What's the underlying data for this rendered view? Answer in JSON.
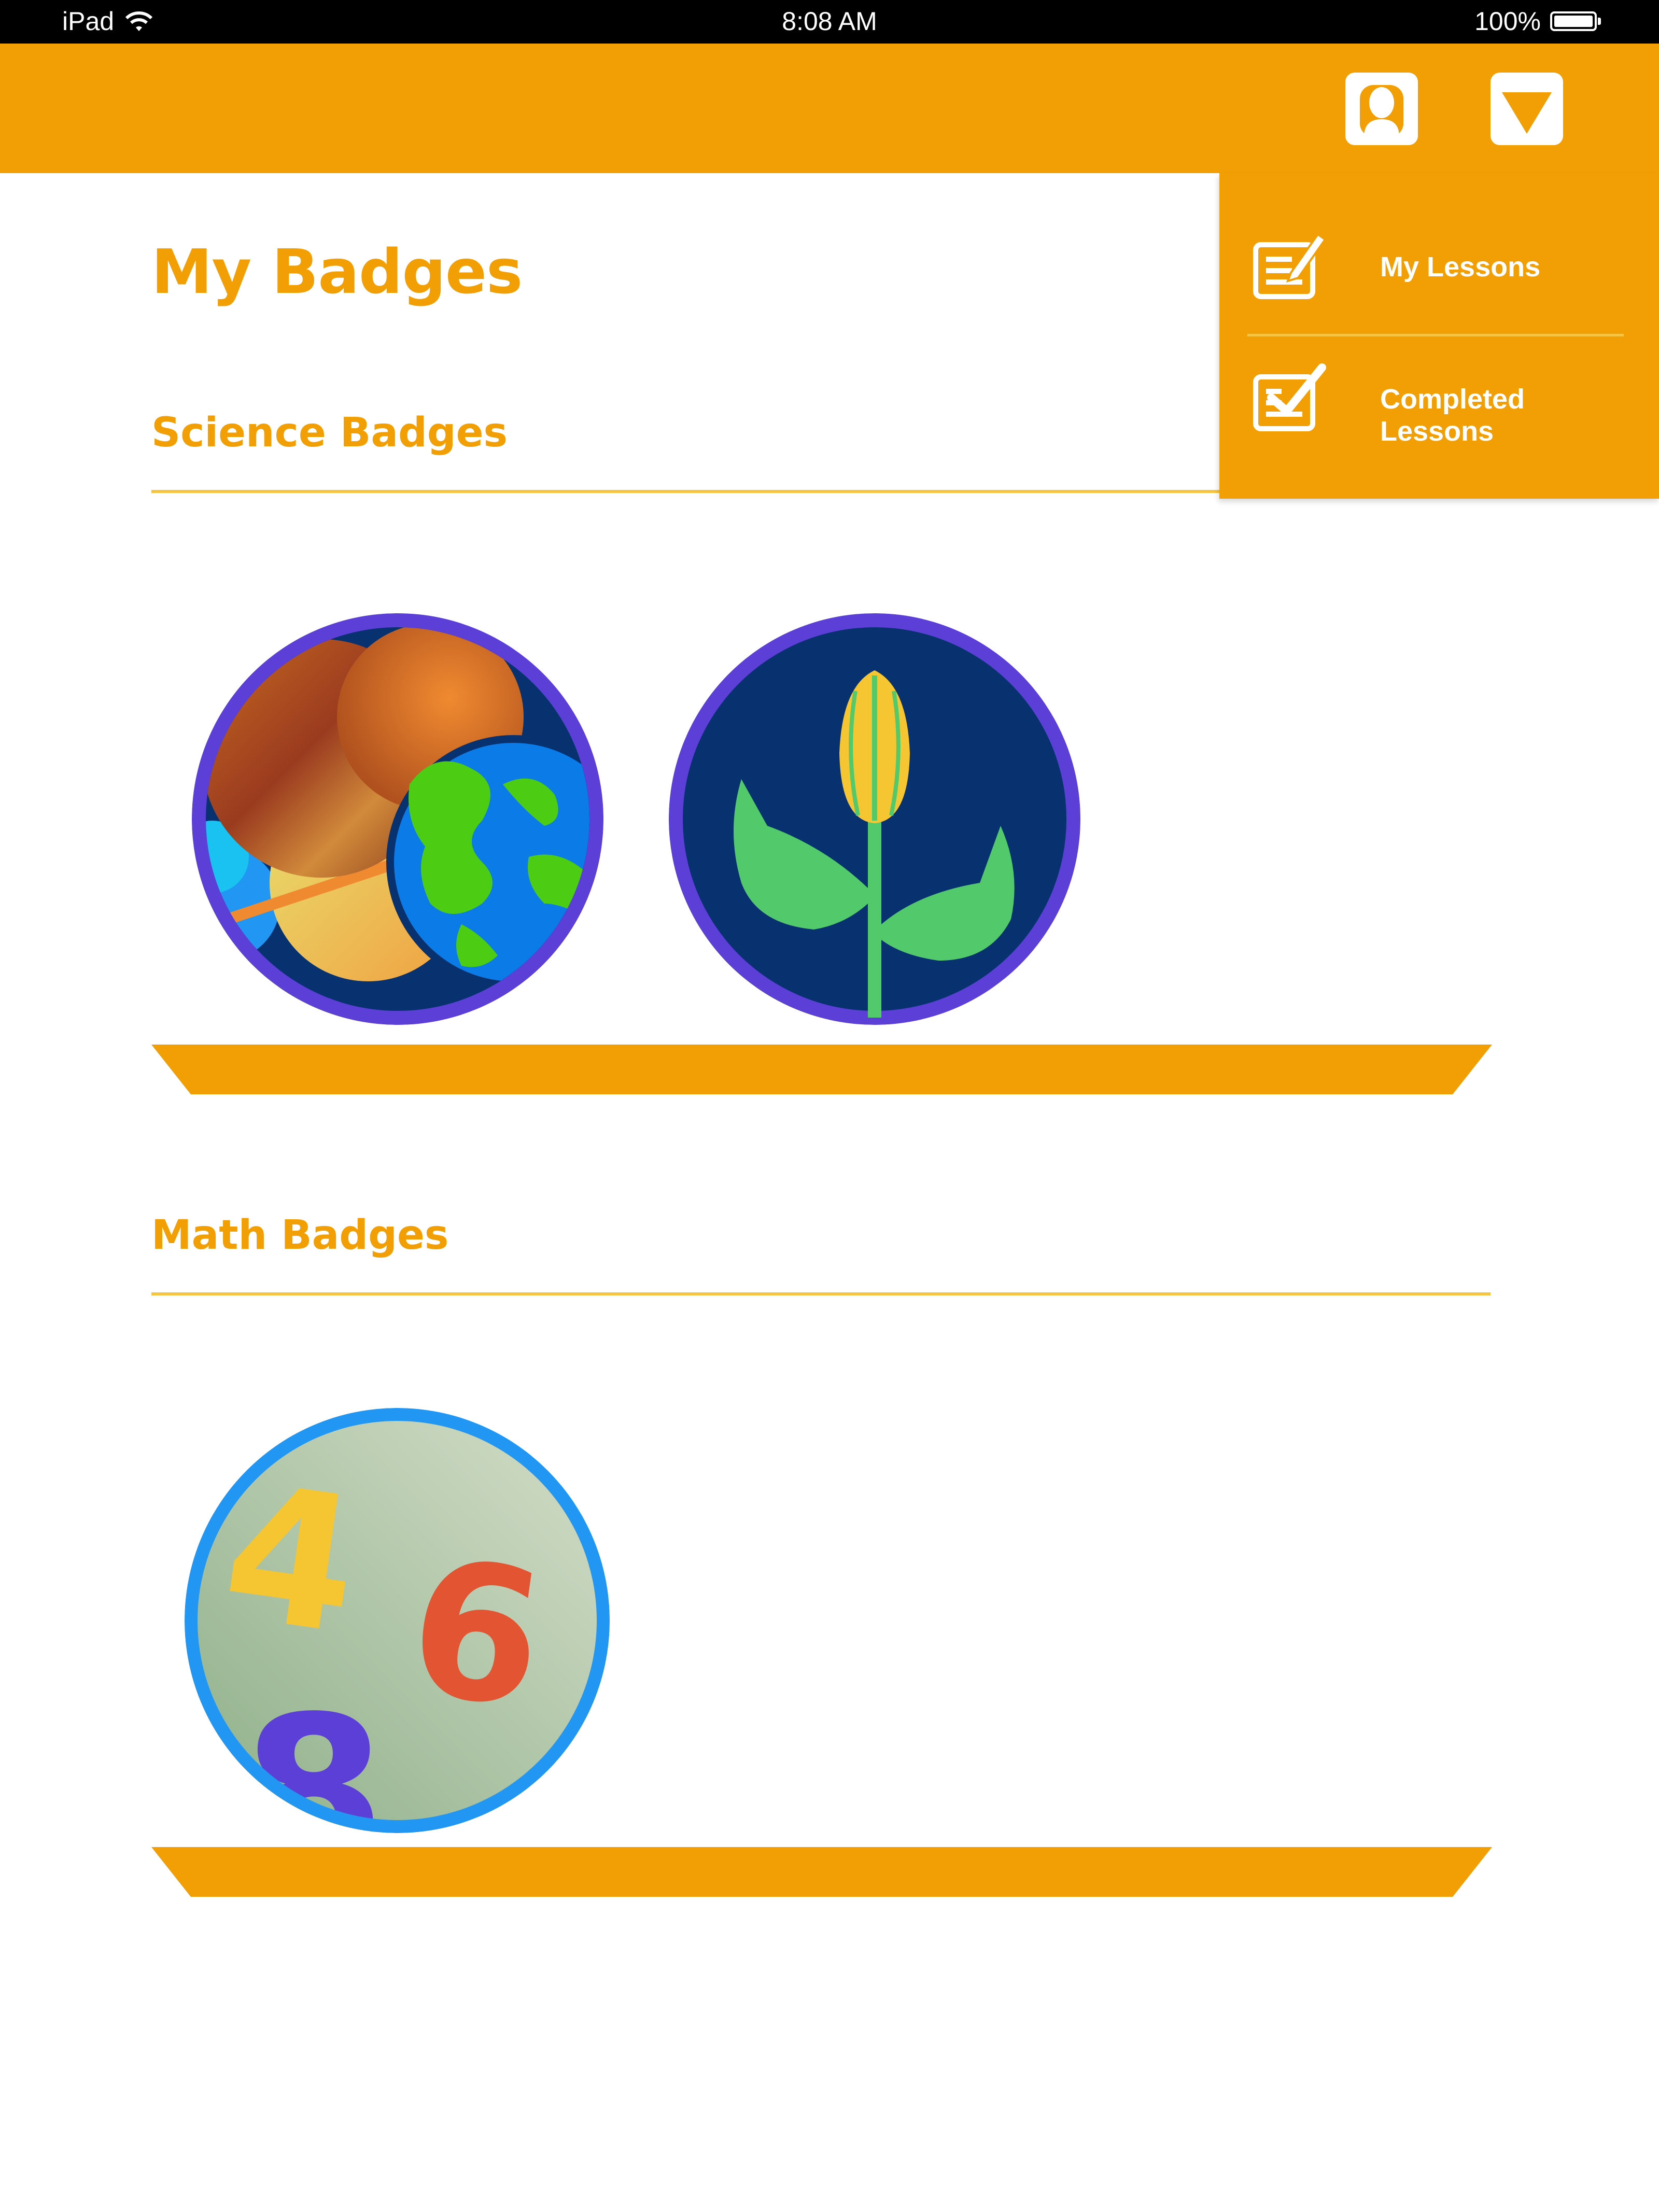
{
  "status_bar": {
    "device": "iPad",
    "time": "8:08 AM",
    "battery": "100%"
  },
  "header": {
    "profile_icon": "profile-icon",
    "menu_icon": "dropdown-triangle-icon"
  },
  "page": {
    "title": "My Badges"
  },
  "sections": [
    {
      "title": "Science Badges",
      "badges": [
        {
          "icon": "planets-badge"
        },
        {
          "icon": "flower-badge"
        }
      ]
    },
    {
      "title": "Math Badges",
      "badges": [
        {
          "icon": "numbers-badge",
          "digits": [
            "4",
            "6",
            "8"
          ]
        }
      ]
    }
  ],
  "dropdown_menu": {
    "items": [
      {
        "label": "My Lessons",
        "icon": "lesson-edit-icon"
      },
      {
        "label": "Completed Lessons",
        "icon": "lesson-check-icon"
      }
    ]
  },
  "colors": {
    "accent": "#f29f05",
    "divider": "#f5c542",
    "science_ring": "#5b3fd6",
    "math_ring": "#2196f3",
    "badge_bg": "#083170"
  }
}
